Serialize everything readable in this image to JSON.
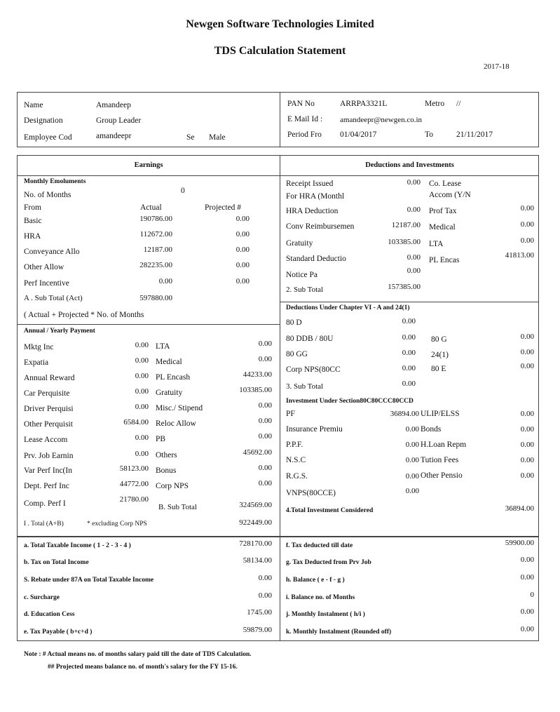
{
  "header": {
    "company": "Newgen Software Technologies Limited",
    "title": "TDS Calculation Statement",
    "year": "2017-18"
  },
  "employee": {
    "name_label": "Name",
    "name": "Amandeep",
    "designation_label": "Designation",
    "designation": "Group Leader",
    "code_label": "Employee Cod",
    "code": "amandeepr",
    "sex_label": "Se",
    "sex": "Male",
    "pan_label": "PAN No",
    "pan": "ARRPA3321L",
    "metro_label": "Metro",
    "metro": "//",
    "email_label": "E Mail Id :",
    "email": "amandeepr@newgen.co.in",
    "period_label": "Period Fro",
    "period_from": "01/04/2017",
    "to_label": "To",
    "period_to": "21/11/2017"
  },
  "earnings": {
    "heading": "Earnings",
    "monthly_heading": "Monthly Emoluments",
    "months_label": "No. of Months",
    "months_value": "0",
    "from_label": "From",
    "actual_label": "Actual",
    "projected_label": "Projected #",
    "rows": [
      {
        "label": "Basic",
        "actual": "190786.00",
        "projected": "0.00"
      },
      {
        "label": "HRA",
        "actual": "112672.00",
        "projected": "0.00"
      },
      {
        "label": "Conveyance Allo",
        "actual": "12187.00",
        "projected": "0.00"
      },
      {
        "label": "Other Allow",
        "actual": "282235.00",
        "projected": "0.00"
      },
      {
        "label": "Perf Incentive",
        "actual": "0.00",
        "projected": "0.00"
      }
    ],
    "subtotal_label": "A . Sub Total (Act)",
    "subtotal_value": "597880.00",
    "formula": "( Actual + Projected * No. of Months",
    "annual_heading": "Annual / Yearly Payment",
    "annual_left": [
      {
        "label": "Mktg Inc",
        "value": "0.00"
      },
      {
        "label": "Expatia",
        "value": "0.00"
      },
      {
        "label": "Annual Reward",
        "value": "0.00"
      },
      {
        "label": "Car Perquisite",
        "value": "0.00"
      },
      {
        "label": "Driver Perquisi",
        "value": "0.00"
      },
      {
        "label": "Other Perquisit",
        "value": "6584.00"
      },
      {
        "label": "Lease Accom",
        "value": "0.00"
      },
      {
        "label": "Prv. Job Earnin",
        "value": "0.00"
      },
      {
        "label": "Var Perf Inc(In",
        "value": "58123.00"
      },
      {
        "label": "Dept. Perf Inc",
        "value": "44772.00"
      },
      {
        "label": "Comp. Perf I",
        "value": "21780.00"
      }
    ],
    "annual_right": [
      {
        "label": "LTA",
        "value": "0.00"
      },
      {
        "label": "Medical",
        "value": "0.00"
      },
      {
        "label": "PL Encash",
        "value": "44233.00"
      },
      {
        "label": "Gratuity",
        "value": "103385.00"
      },
      {
        "label": "Misc./ Stipend",
        "value": "0.00"
      },
      {
        "label": "Reloc Allow",
        "value": "0.00"
      },
      {
        "label": "PB",
        "value": "0.00"
      },
      {
        "label": "Others",
        "value": "45692.00"
      },
      {
        "label": "Bonus",
        "value": "0.00"
      },
      {
        "label": "Corp NPS",
        "value": "0.00"
      }
    ],
    "b_subtotal_label": "B. Sub Total",
    "b_subtotal_value": "324569.00",
    "total_label": "I . Total (A+B)",
    "total_note": "* excluding Corp NPS",
    "total_value": "922449.00"
  },
  "deductions": {
    "heading": "Deductions and Investments",
    "left": [
      {
        "label": "Receipt Issued",
        "value": "0.00"
      },
      {
        "label": "For HRA (Monthl",
        "value": ""
      },
      {
        "label": "HRA Deduction",
        "value": "0.00"
      },
      {
        "label": "Conv Reimbursemen",
        "value": "12187.00"
      },
      {
        "label": "Gratuity",
        "value": "103385.00"
      },
      {
        "label": "Standard Deductio",
        "value": "0.00"
      },
      {
        "label": "Notice Pa",
        "value": "0.00"
      }
    ],
    "right": [
      {
        "label": "Co. Lease",
        "value": ""
      },
      {
        "label": "Accom (Y/N",
        "value": ""
      },
      {
        "label": "Prof Tax",
        "value": "0.00"
      },
      {
        "label": "Medical",
        "value": "0.00"
      },
      {
        "label": "LTA",
        "value": "0.00"
      },
      {
        "label": "PL Encas",
        "value": "41813.00"
      }
    ],
    "sub2_label": "2. Sub Total",
    "sub2_value": "157385.00",
    "chapter_heading": "Deductions Under Chapter VI - A and 24(1)",
    "chapter_left": [
      {
        "label": "80 D",
        "value": "0.00"
      },
      {
        "label": "80 DDB / 80U",
        "value": "0.00"
      },
      {
        "label": "80 GG",
        "value": "0.00"
      },
      {
        "label": "Corp NPS(80CC",
        "value": "0.00"
      }
    ],
    "chapter_right": [
      {
        "label": "80 G",
        "value": "0.00"
      },
      {
        "label": "24(1)",
        "value": "0.00"
      },
      {
        "label": "80 E",
        "value": "0.00"
      }
    ],
    "sub3_label": "3. Sub Total",
    "sub3_value": "0.00",
    "invest_heading": "Investment Under Section80C80CCC80CCD",
    "invest_left": [
      {
        "label": "PF",
        "value": "36894.00"
      },
      {
        "label": "Insurance Premiu",
        "value": "0.00"
      },
      {
        "label": "P.P.F.",
        "value": "0.00"
      },
      {
        "label": "N.S.C",
        "value": "0.00"
      },
      {
        "label": "R.G.S.",
        "value": "0.00"
      },
      {
        "label": "VNPS(80CCE)",
        "value": "0.00"
      }
    ],
    "invest_right": [
      {
        "label": "ULIP/ELSS",
        "value": "0.00"
      },
      {
        "label": "Bonds",
        "value": "0.00"
      },
      {
        "label": "H.Loan Repm",
        "value": "0.00"
      },
      {
        "label": "Tution Fees",
        "value": "0.00"
      },
      {
        "label": "Other Pensio",
        "value": "0.00"
      }
    ],
    "total_invest_label": "4.Total Investment Considered",
    "total_invest_value": "36894.00"
  },
  "summary": {
    "left": [
      {
        "label": "a. Total Taxable Income ( 1 - 2 - 3 - 4 )",
        "value": "728170.00"
      },
      {
        "label": "b. Tax on Total Income",
        "value": "58134.00"
      },
      {
        "label": "S. Rebate under 87A on Total Taxable Income",
        "value": "0.00"
      },
      {
        "label": "c. Surcharge",
        "value": "0.00"
      },
      {
        "label": "d. Education Cess",
        "value": "1745.00"
      },
      {
        "label": "e. Tax Payable ( b+c+d )",
        "value": "59879.00"
      }
    ],
    "right": [
      {
        "label": "f. Tax deducted till date",
        "value": "59900.00"
      },
      {
        "label": "g. Tax Deducted from Prv Job",
        "value": "0.00"
      },
      {
        "label": "h. Balance ( e - f - g )",
        "value": "0.00"
      },
      {
        "label": "i. Balance no. of Months",
        "value": "0"
      },
      {
        "label": "j. Monthly Instalment ( h/i )",
        "value": "0.00"
      },
      {
        "label": "k. Monthly Instalment (Rounded off)",
        "value": "0.00"
      }
    ]
  },
  "notes": {
    "note1": "Note : # Actual means no. of months salary paid till the date of TDS Calculation.",
    "note2": "## Projected means balance no. of month's salary for the FY 15-16."
  }
}
